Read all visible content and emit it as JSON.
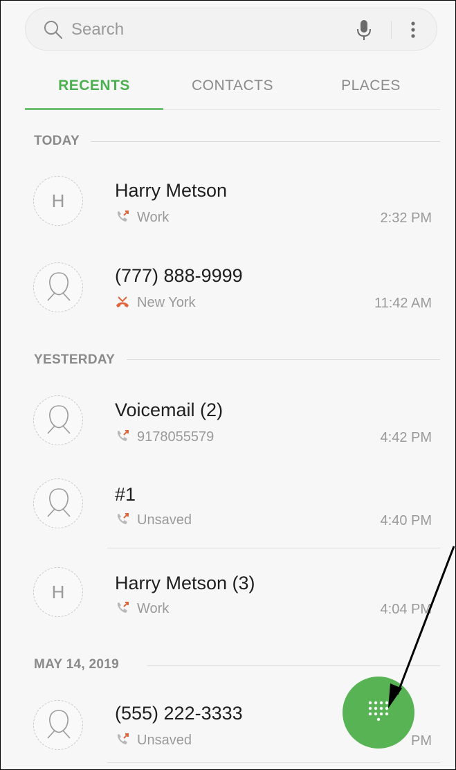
{
  "search": {
    "placeholder": "Search"
  },
  "tabs": [
    {
      "label": "RECENTS",
      "active": true
    },
    {
      "label": "CONTACTS",
      "active": false
    },
    {
      "label": "PLACES",
      "active": false
    }
  ],
  "sections": [
    {
      "label": "TODAY"
    },
    {
      "label": "YESTERDAY"
    },
    {
      "label": "MAY 14, 2019"
    }
  ],
  "calls": [
    {
      "name": "Harry Metson",
      "avatar": "H",
      "detail": "Work",
      "call_type": "outgoing",
      "time": "2:32 PM"
    },
    {
      "name": "(777) 888-9999",
      "avatar": "silhouette",
      "detail": "New York",
      "call_type": "missed",
      "time": "11:42 AM"
    },
    {
      "name": "Voicemail (2)",
      "avatar": "silhouette",
      "detail": "9178055579",
      "call_type": "outgoing",
      "time": "4:42 PM"
    },
    {
      "name": "#1",
      "avatar": "silhouette",
      "detail": "Unsaved",
      "call_type": "outgoing",
      "time": "4:40 PM"
    },
    {
      "name": "Harry Metson (3)",
      "avatar": "H",
      "detail": "Work",
      "call_type": "outgoing",
      "time": "4:04 PM"
    },
    {
      "name": "(555) 222-3333",
      "avatar": "silhouette",
      "detail": "Unsaved",
      "call_type": "outgoing",
      "time": "PM"
    }
  ],
  "colors": {
    "accent": "#4caf50",
    "fab": "#58b354",
    "missed": "#e0643c",
    "outgoing_arrow": "#e0643c"
  },
  "icons": {
    "search": "search-icon",
    "mic": "microphone-icon",
    "more": "more-vert-icon",
    "keypad": "dialpad-icon",
    "outgoing": "outgoing-call-icon",
    "missed": "missed-call-icon"
  }
}
